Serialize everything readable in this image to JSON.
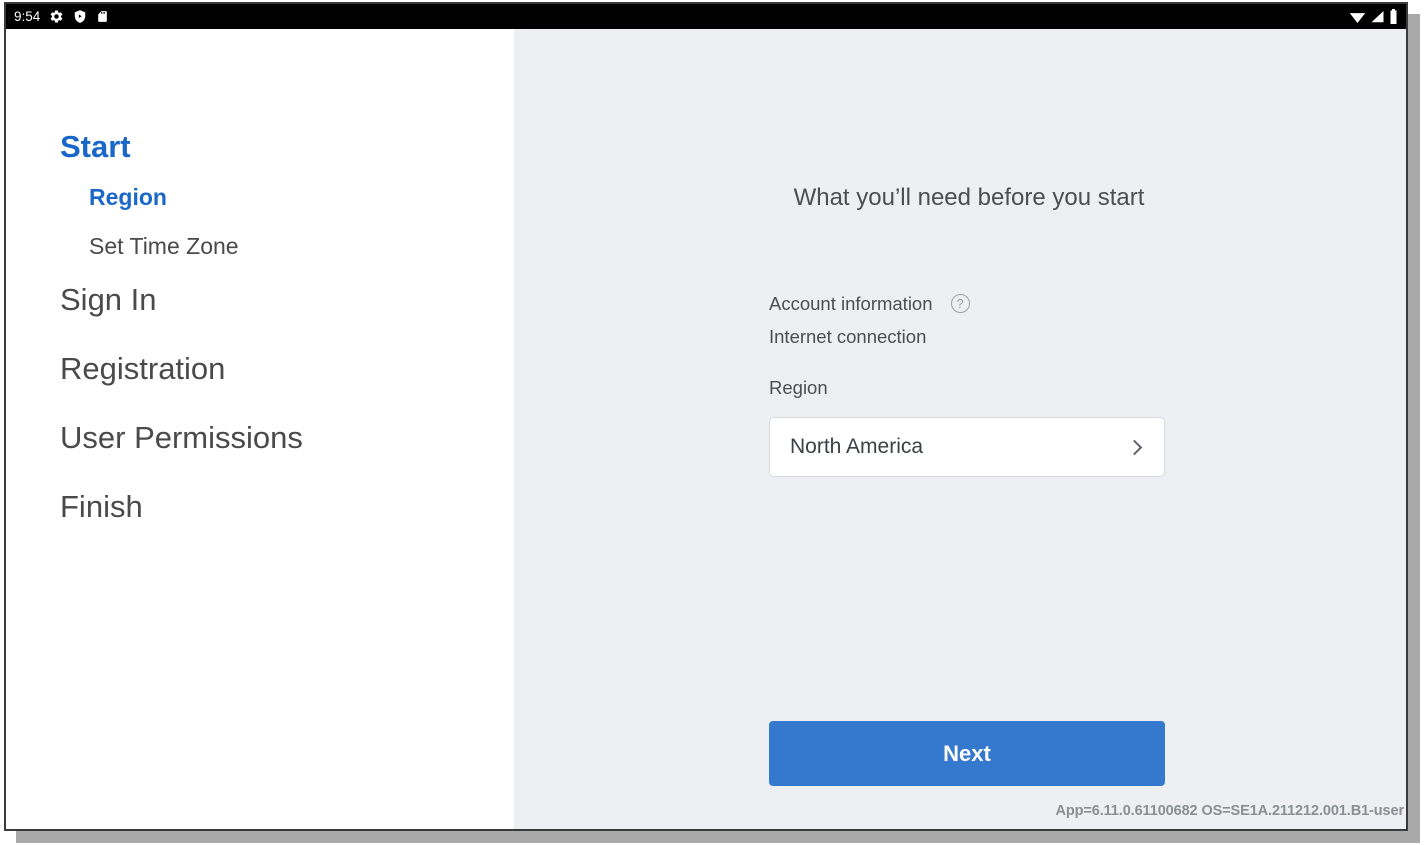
{
  "status_bar": {
    "clock": "9:54",
    "left_icons": [
      "gear-icon",
      "shield-play-icon",
      "sd-card-icon"
    ],
    "right_icons": [
      "wifi-icon",
      "cellular-signal-icon",
      "battery-icon"
    ],
    "background_color": "#000000"
  },
  "sidebar": {
    "items": [
      {
        "label": "Start",
        "level": 0,
        "active": true
      },
      {
        "label": "Region",
        "level": 1,
        "active": true
      },
      {
        "label": "Set Time Zone",
        "level": 1,
        "active": false
      },
      {
        "label": "Sign In",
        "level": 0,
        "active": false
      },
      {
        "label": "Registration",
        "level": 0,
        "active": false
      },
      {
        "label": "User Permissions",
        "level": 0,
        "active": false
      },
      {
        "label": "Finish",
        "level": 0,
        "active": false
      }
    ],
    "active_color": "#1967c8",
    "inactive_color": "#4a4a4a",
    "background_color": "#ffffff"
  },
  "main": {
    "heading": "What you’ll need before you start",
    "background_color": "#edeff2",
    "requirements": [
      {
        "label": "Account information",
        "help_icon": "help-circle-icon"
      },
      {
        "label": "Internet connection",
        "help_icon": null
      }
    ],
    "region": {
      "label": "Region",
      "value": "North America",
      "chevron": "chevron-right-icon"
    },
    "next_button": {
      "label": "Next",
      "color": "#3579ce",
      "text_color": "#ffffff"
    },
    "version_footer": "App=6.11.0.61100682 OS=SE1A.211212.001.B1-user"
  }
}
